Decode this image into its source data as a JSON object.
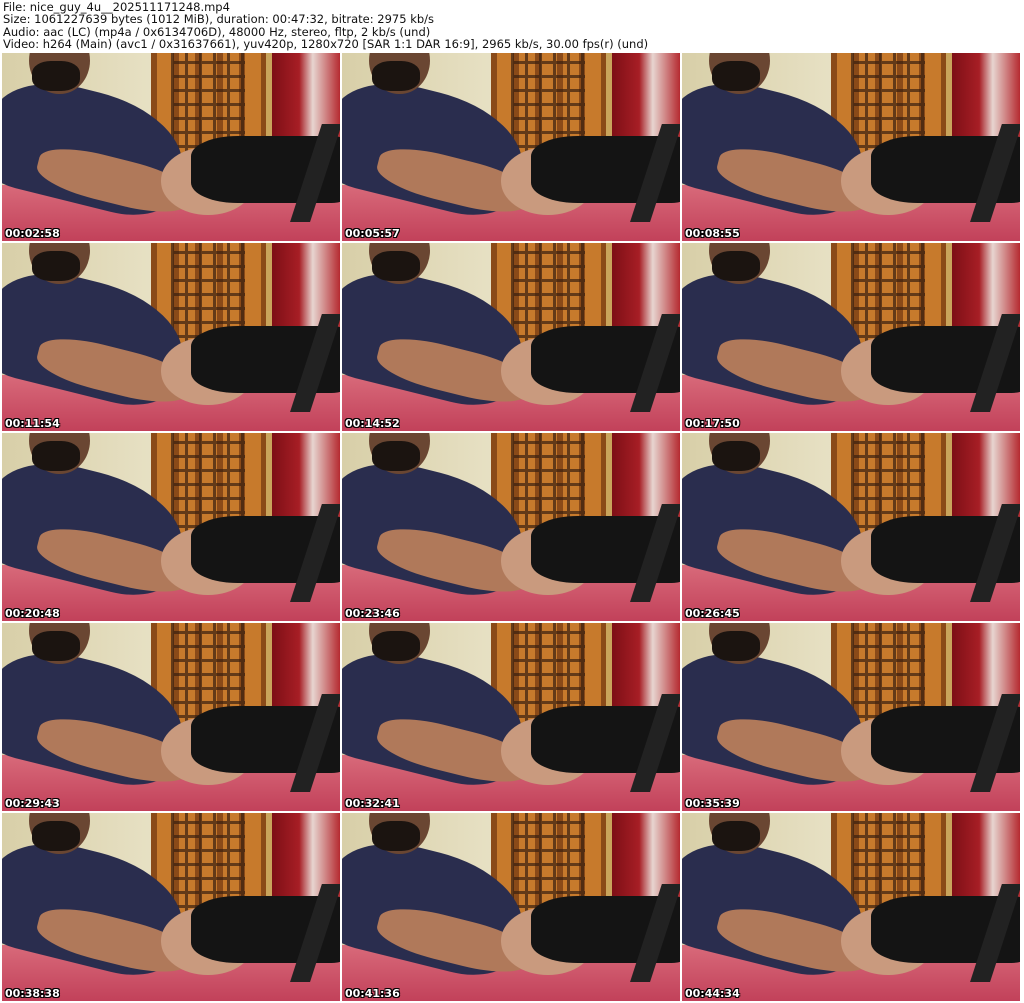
{
  "header": {
    "file": "File: nice_guy_4u__202511171248.mp4",
    "size": "Size: 1061227639 bytes (1012 MiB), duration: 00:47:32, bitrate: 2975 kb/s",
    "audio": "Audio: aac (LC) (mp4a / 0x6134706D), 48000 Hz, stereo, fltp, 2 kb/s (und)",
    "video": "Video: h264 (Main) (avc1 / 0x31637661), yuv420p, 1280x720 [SAR 1:1 DAR 16:9], 2965 kb/s, 30.00 fps(r) (und)"
  },
  "thumbnails": [
    {
      "timestamp": "00:02:58"
    },
    {
      "timestamp": "00:05:57"
    },
    {
      "timestamp": "00:08:55"
    },
    {
      "timestamp": "00:11:54"
    },
    {
      "timestamp": "00:14:52"
    },
    {
      "timestamp": "00:17:50"
    },
    {
      "timestamp": "00:20:48"
    },
    {
      "timestamp": "00:23:46"
    },
    {
      "timestamp": "00:26:45"
    },
    {
      "timestamp": "00:29:43"
    },
    {
      "timestamp": "00:32:41"
    },
    {
      "timestamp": "00:35:39"
    },
    {
      "timestamp": "00:38:38"
    },
    {
      "timestamp": "00:41:36"
    },
    {
      "timestamp": "00:44:34"
    }
  ]
}
